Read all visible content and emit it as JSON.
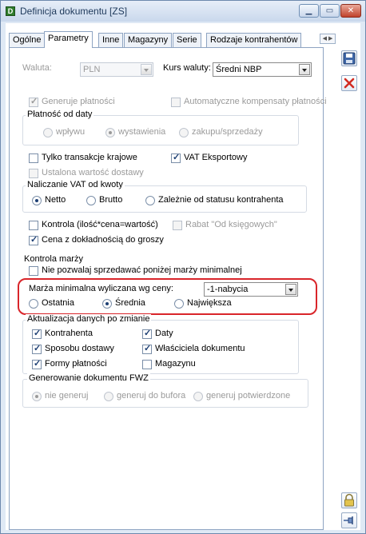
{
  "window": {
    "title": "Definicja dokumentu [ZS]"
  },
  "tabs": [
    "Ogólne",
    "Parametry",
    "Inne",
    "Magazyny",
    "Serie",
    "Rodzaje kontrahentów"
  ],
  "waluta": {
    "label": "Waluta:",
    "value": "PLN"
  },
  "kurs": {
    "label": "Kurs waluty:",
    "value": "Średni NBP"
  },
  "generuje": "Generuje płatności",
  "automatyczne": "Automatyczne kompensaty płatności",
  "platnosc_group": {
    "title": "Płatność od daty",
    "options": [
      "wpływu",
      "wystawienia",
      "zakupu/sprzedaży"
    ]
  },
  "transakcje": "Tylko transakcje krajowe",
  "vat_eksport": "VAT Eksportowy",
  "ustalona": "Ustalona wartość dostawy",
  "vat_group": {
    "title": "Naliczanie VAT od kwoty",
    "options": [
      "Netto",
      "Brutto",
      "Zależnie od statusu kontrahenta"
    ]
  },
  "kontrola": "Kontrola (ilość*cena=wartość)",
  "rabat": "Rabat \"Od księgowych\"",
  "cena_grosze": "Cena z dokładnością do groszy",
  "marza_group": {
    "title": "Kontrola marży",
    "nie_pozwalaj": "Nie pozwalaj sprzedawać poniżej marży minimalnej"
  },
  "marza_min": {
    "label": "Marża minimalna wyliczana wg ceny:",
    "value": "-1-nabycia",
    "options": [
      "Ostatnia",
      "Średnia",
      "Największa"
    ]
  },
  "aktualizacja": {
    "title": "Aktualizacja danych po zmianie",
    "col1": [
      "Kontrahenta",
      "Sposobu dostawy",
      "Formy płatności"
    ],
    "col2": [
      "Daty",
      "Właściciela dokumentu",
      "Magazynu"
    ]
  },
  "fwz": {
    "title": "Generowanie dokumentu FWZ",
    "options": [
      "nie generuj",
      "generuj do bufora",
      "generuj potwierdzone"
    ]
  },
  "colors": {
    "highlight": "#d9252a",
    "accent": "#1d3f73"
  },
  "icons": [
    "app-icon",
    "save-icon",
    "cancel-icon",
    "lock-icon",
    "pin-icon"
  ]
}
